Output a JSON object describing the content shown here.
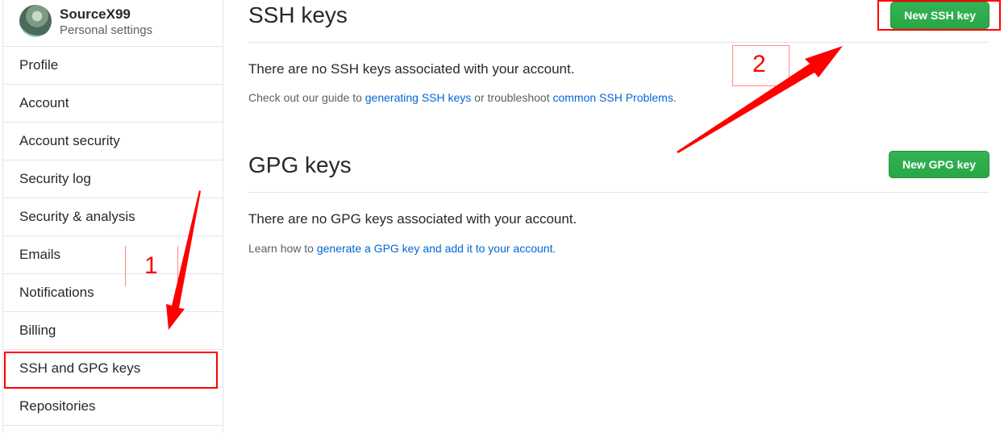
{
  "user": {
    "name": "SourceX99",
    "subtitle": "Personal settings"
  },
  "sidebar": {
    "items": [
      {
        "label": "Profile"
      },
      {
        "label": "Account"
      },
      {
        "label": "Account security"
      },
      {
        "label": "Security log"
      },
      {
        "label": "Security & analysis"
      },
      {
        "label": "Emails"
      },
      {
        "label": "Notifications"
      },
      {
        "label": "Billing"
      },
      {
        "label": "SSH and GPG keys",
        "selected": true
      },
      {
        "label": "Repositories"
      }
    ]
  },
  "ssh": {
    "title": "SSH keys",
    "button": "New SSH key",
    "empty": "There are no SSH keys associated with your account.",
    "help_prefix": "Check out our guide to ",
    "help_link1": "generating SSH keys",
    "help_middle": " or troubleshoot ",
    "help_link2": "common SSH Problems",
    "help_suffix": "."
  },
  "gpg": {
    "title": "GPG keys",
    "button": "New GPG key",
    "empty": "There are no GPG keys associated with your account.",
    "help_prefix": "Learn how to ",
    "help_link": "generate a GPG key and add it to your account",
    "help_suffix": "."
  },
  "annotations": {
    "step1": "1",
    "step2": "2",
    "color": "#ff0000"
  },
  "colors": {
    "accent_green": "#28a745",
    "link_blue": "#0366d6"
  }
}
